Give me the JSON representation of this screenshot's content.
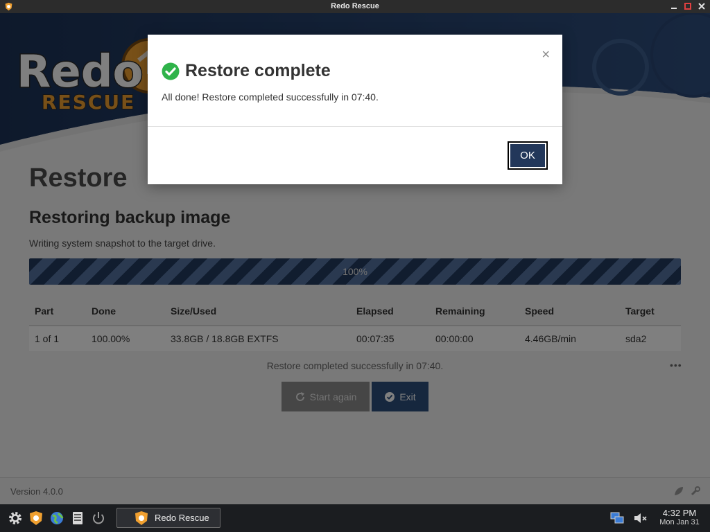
{
  "window": {
    "title": "Redo Rescue"
  },
  "logo": {
    "word1": "Redo",
    "word2": "RESCUE"
  },
  "page": {
    "title": "Restore",
    "section_title": "Restoring backup image",
    "section_desc": "Writing system snapshot to the target drive.",
    "progress": {
      "percent": 100,
      "label": "100%"
    },
    "table": {
      "headers": [
        "Part",
        "Done",
        "Size/Used",
        "Elapsed",
        "Remaining",
        "Speed",
        "Target"
      ],
      "rows": [
        [
          "1 of 1",
          "100.00%",
          "33.8GB / 18.8GB EXTFS",
          "00:07:35",
          "00:00:00",
          "4.46GB/min",
          "sda2"
        ]
      ]
    },
    "status_text": "Restore completed successfully in 07:40.",
    "more": "•••",
    "start_again_label": "Start again",
    "exit_label": "Exit"
  },
  "footer": {
    "version": "Version 4.0.0"
  },
  "modal": {
    "title": "Restore complete",
    "body": "All done! Restore completed successfully in 07:40.",
    "close": "×",
    "ok_label": "OK"
  },
  "taskbar": {
    "task_label": "Redo Rescue",
    "time": "4:32 PM",
    "date": "Mon Jan 31"
  },
  "colors": {
    "accent": "#22375a",
    "success": "#2fb34a",
    "logo_orange": "#f0a030"
  }
}
